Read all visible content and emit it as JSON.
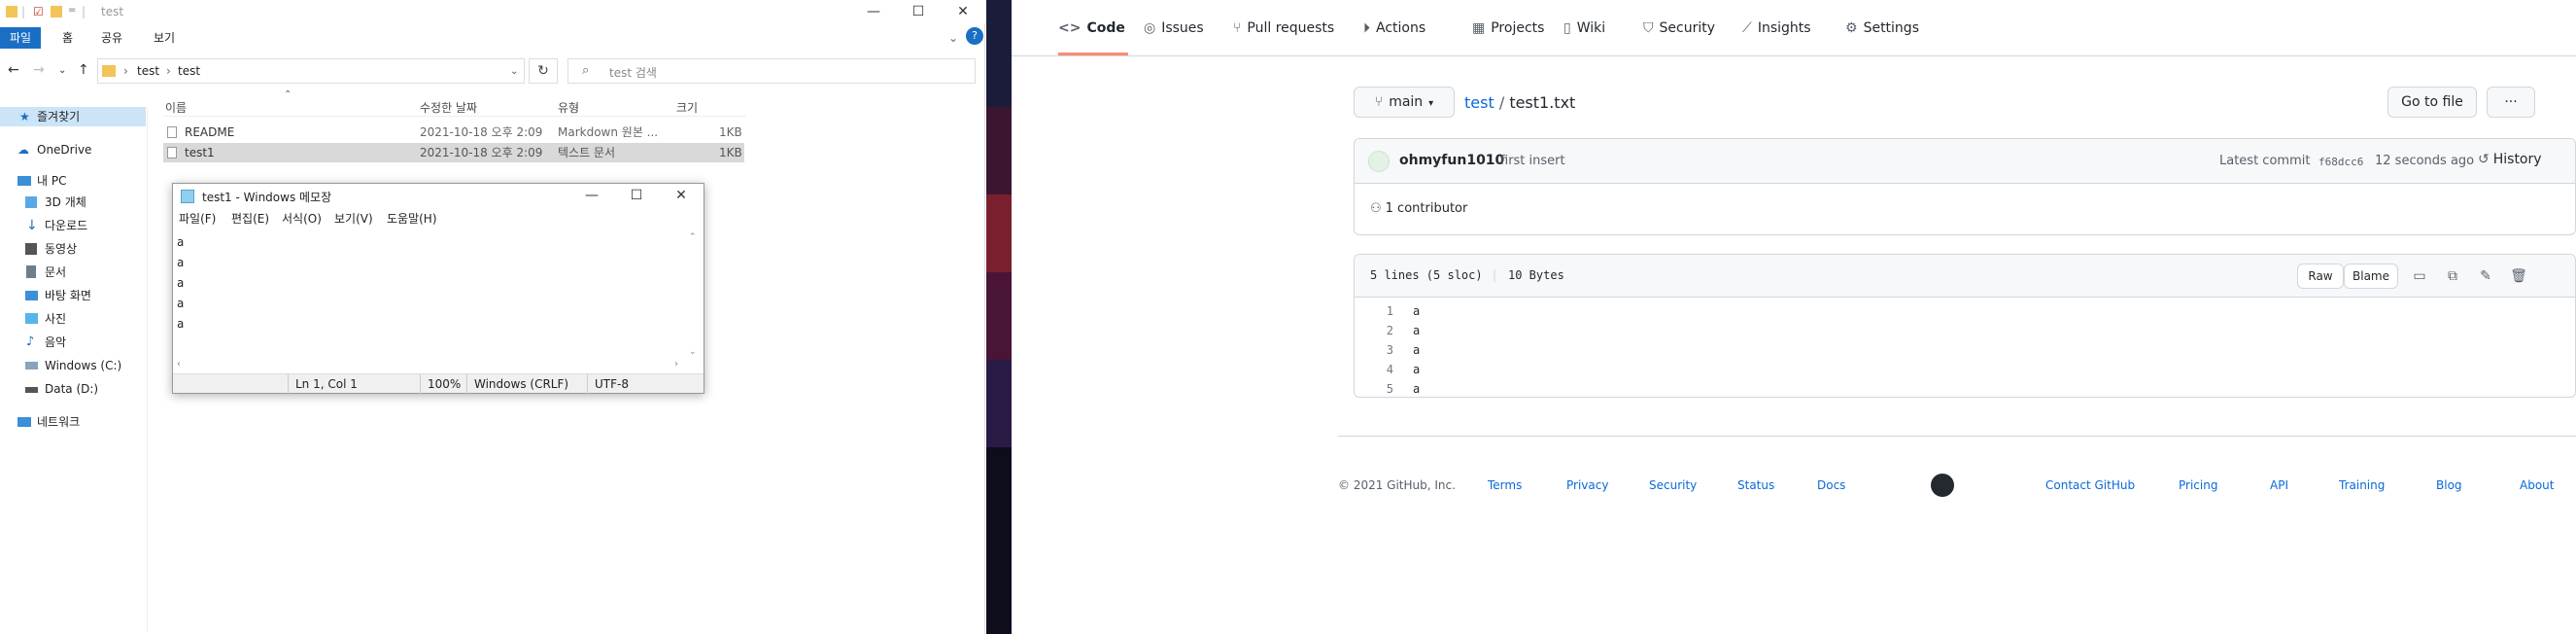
{
  "explorer": {
    "title": "test",
    "ribbon_tabs": [
      "파일",
      "홈",
      "공유",
      "보기"
    ],
    "breadcrumb": [
      "test",
      "test"
    ],
    "search_placeholder": "test 검색",
    "columns": [
      "이름",
      "수정한 날짜",
      "유형",
      "크기"
    ],
    "files": [
      {
        "name": "README",
        "date": "2021-10-18 오후 2:09",
        "type": "Markdown 원본 ...",
        "size": "1KB"
      },
      {
        "name": "test1",
        "date": "2021-10-18 오후 2:09",
        "type": "텍스트 문서",
        "size": "1KB"
      }
    ],
    "nav": [
      {
        "label": "즐겨찾기"
      },
      {
        "label": "OneDrive"
      },
      {
        "label": "내 PC"
      },
      {
        "label": "3D 개체"
      },
      {
        "label": "다운로드"
      },
      {
        "label": "동영상"
      },
      {
        "label": "문서"
      },
      {
        "label": "바탕 화면"
      },
      {
        "label": "사진"
      },
      {
        "label": "음악"
      },
      {
        "label": "Windows (C:)"
      },
      {
        "label": "Data (D:)"
      },
      {
        "label": "네트워크"
      }
    ]
  },
  "notepad": {
    "title": "test1 - Windows 메모장",
    "menu": [
      "파일(F)",
      "편집(E)",
      "서식(O)",
      "보기(V)",
      "도움말(H)"
    ],
    "lines": [
      "a",
      "a",
      "a",
      "a",
      "a"
    ],
    "status": {
      "pos": "Ln 1, Col 1",
      "zoom": "100%",
      "eol": "Windows (CRLF)",
      "enc": "UTF-8"
    }
  },
  "github": {
    "tabs": [
      "Code",
      "Issues",
      "Pull requests",
      "Actions",
      "Projects",
      "Wiki",
      "Security",
      "Insights",
      "Settings"
    ],
    "branch": "main",
    "repo": "test",
    "path_sep": "/",
    "file": "test1.txt",
    "go_to_file": "Go to file",
    "more": "···",
    "commit": {
      "author": "ohmyfun1010",
      "message": "first insert",
      "latest_label": "Latest commit",
      "sha": "f68dcc6",
      "time": "12 seconds ago",
      "history": "History",
      "contributors": "1 contributor"
    },
    "file_info": {
      "lines": "5 lines (5 sloc)",
      "size": "10 Bytes",
      "raw": "Raw",
      "blame": "Blame"
    },
    "code_lines": [
      {
        "n": "1",
        "t": "a"
      },
      {
        "n": "2",
        "t": "a"
      },
      {
        "n": "3",
        "t": "a"
      },
      {
        "n": "4",
        "t": "a"
      },
      {
        "n": "5",
        "t": "a"
      }
    ],
    "footer": {
      "copyright": "© 2021 GitHub, Inc.",
      "links": [
        "Terms",
        "Privacy",
        "Security",
        "Status",
        "Docs",
        "Contact GitHub",
        "Pricing",
        "API",
        "Training",
        "Blog",
        "About"
      ]
    }
  }
}
